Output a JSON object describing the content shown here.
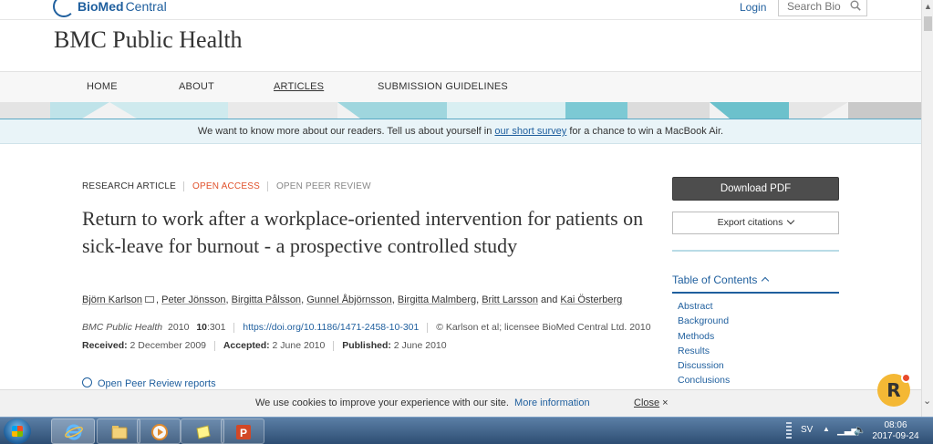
{
  "header": {
    "logo_bio": "BioMed",
    "logo_central": "Central",
    "login": "Login",
    "search_placeholder": "Search Bio"
  },
  "journal": {
    "title": "BMC Public Health"
  },
  "nav": {
    "home": "HOME",
    "about": "ABOUT",
    "articles": "ARTICLES",
    "guidelines": "SUBMISSION GUIDELINES"
  },
  "survey": {
    "before": "We want to know more about our readers. Tell us about yourself in ",
    "link": "our short survey",
    "after": " for a chance to win a MacBook Air."
  },
  "article": {
    "type": "RESEARCH ARTICLE",
    "open_access": "OPEN ACCESS",
    "open_peer_review": "OPEN PEER REVIEW",
    "title": "Return to work after a workplace-oriented intervention for patients on sick-leave for burnout - a prospective controlled study",
    "authors": [
      "Björn Karlson",
      "Peter Jönsson",
      "Birgitta Pålsson",
      "Gunnel Åbjörnsson",
      "Birgitta Malmberg",
      "Britt Larsson",
      "Kai Österberg"
    ],
    "author_sep": ", ",
    "author_and": " and ",
    "citation_journal": "BMC Public Health",
    "citation_year": "2010",
    "citation_volume": "10",
    "citation_page": ":301",
    "doi": "https://doi.org/10.1186/1471-2458-10-301",
    "copyright": "© Karlson et al; licensee BioMed Central Ltd. 2010",
    "received_label": "Received:",
    "received": "2 December 2009",
    "accepted_label": "Accepted:",
    "accepted": "2 June 2010",
    "published_label": "Published:",
    "published": "2 June 2010",
    "peer_review_link": "Open Peer Review reports"
  },
  "sidebar": {
    "download_pdf": "Download PDF",
    "export_citations": "Export citations",
    "toc_title": "Table of Contents",
    "toc": [
      "Abstract",
      "Background",
      "Methods",
      "Results",
      "Discussion",
      "Conclusions"
    ]
  },
  "cookie": {
    "text": "We use cookies to improve your experience with our site.",
    "more": "More information",
    "close": "Close",
    "close_x": "×"
  },
  "badge": {
    "letter": "R"
  },
  "taskbar": {
    "lang": "SV",
    "time": "08:06",
    "date": "2017-09-24",
    "apps": [
      "internet-explorer",
      "file-explorer",
      "media-player",
      "sticky-notes",
      "powerpoint"
    ]
  },
  "colors": {
    "brand_blue": "#1f5f9e",
    "open_access": "#e0512b",
    "button_dark": "#4d4d4d",
    "badge": "#f4b835",
    "survey_bg": "#e9f4f8"
  }
}
